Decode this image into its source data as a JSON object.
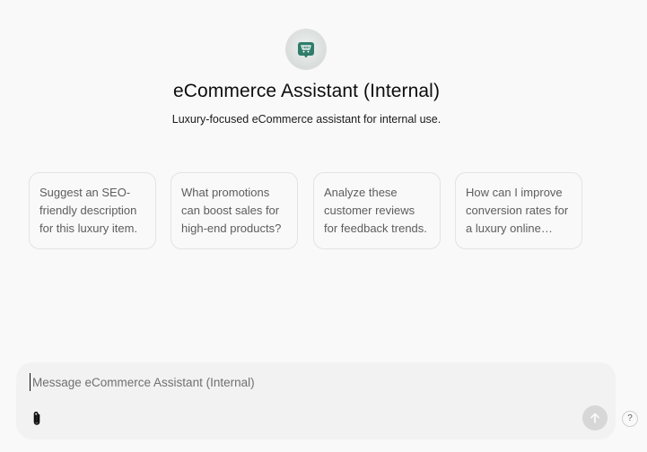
{
  "assistant": {
    "title": "eCommerce Assistant (Internal)",
    "description": "Luxury-focused eCommerce assistant for internal use.",
    "avatar_icon": "shopping-cart-tag-icon",
    "accent_color": "#2f7d6b"
  },
  "suggestions": [
    {
      "text": "Suggest an SEO-friendly description for this luxury item."
    },
    {
      "text": "What promotions can boost sales for high-end products?"
    },
    {
      "text": "Analyze these customer reviews for feedback trends."
    },
    {
      "text": "How can I improve conversion rates for a luxury online store?"
    }
  ],
  "composer": {
    "placeholder": "Message eCommerce Assistant (Internal)",
    "value": "",
    "attach_icon": "paperclip-icon",
    "send_icon": "arrow-up-icon"
  },
  "help": {
    "label": "?"
  }
}
